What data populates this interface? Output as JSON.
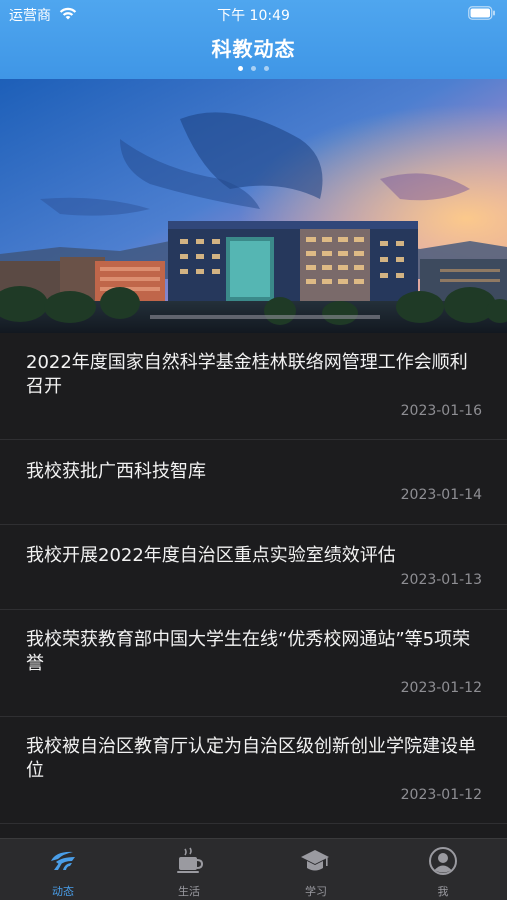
{
  "status_bar": {
    "carrier": "运营商",
    "time": "下午 10:49"
  },
  "header": {
    "title": "科教动态",
    "page_indicator": {
      "count": 3,
      "active_index": 0
    }
  },
  "banner": {
    "image": "campus-building-at-dusk"
  },
  "news": [
    {
      "title": "2022年度国家自然科学基金桂林联络网管理工作会顺利召开",
      "date": "2023-01-16"
    },
    {
      "title": "我校获批广西科技智库",
      "date": "2023-01-14"
    },
    {
      "title": "我校开展2022年度自治区重点实验室绩效评估",
      "date": "2023-01-13"
    },
    {
      "title": "我校荣获教育部中国大学生在线“优秀校网通站”等5项荣誉",
      "date": "2023-01-12"
    },
    {
      "title": "我校被自治区教育厅认定为自治区级创新创业学院建设单位",
      "date": "2023-01-12"
    }
  ],
  "tab_bar": {
    "tabs": [
      {
        "label": "动态",
        "icon": "news-logo-icon",
        "active": true
      },
      {
        "label": "生活",
        "icon": "coffee-cup-icon",
        "active": false
      },
      {
        "label": "学习",
        "icon": "graduation-cap-icon",
        "active": false
      },
      {
        "label": "我",
        "icon": "user-icon",
        "active": false
      }
    ]
  },
  "colors": {
    "header_blue": "#3f96e6",
    "background": "#1c1c1e",
    "tab_active": "#4a9ee8",
    "tab_inactive": "#9a9aa0",
    "date_gray": "#8e8e93"
  }
}
